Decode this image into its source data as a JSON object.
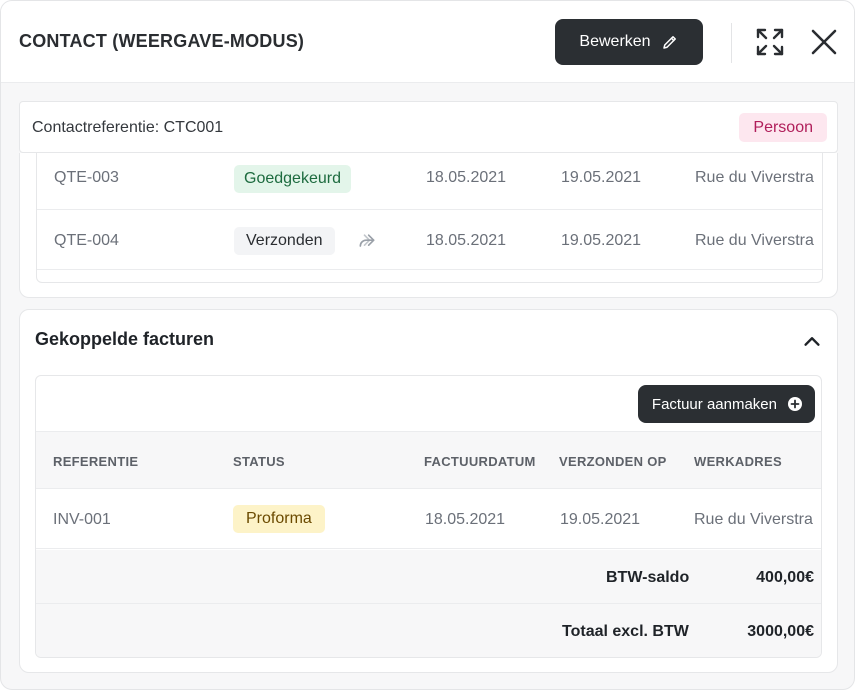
{
  "header": {
    "title": "CONTACT (WEERGAVE-MODUS)",
    "edit_label": "Bewerken"
  },
  "contact": {
    "reference": "Contactreferentie: CTC001",
    "type_badge": "Persoon"
  },
  "quotes": {
    "rows": [
      {
        "ref": "QTE-003",
        "status": "Goedgekeurd",
        "date1": "18.05.2021",
        "date2": "19.05.2021",
        "address": "Rue du Viverstra"
      },
      {
        "ref": "QTE-004",
        "status": "Verzonden",
        "date1": "18.05.2021",
        "date2": "19.05.2021",
        "address": "Rue du Viverstra"
      }
    ]
  },
  "invoices": {
    "title": "Gekoppelde facturen",
    "create_label": "Factuur aanmaken",
    "columns": [
      "REFERENTIE",
      "STATUS",
      "FACTUURDATUM",
      "VERZONDEN OP",
      "WERKADRES"
    ],
    "rows": [
      {
        "ref": "INV-001",
        "status": "Proforma",
        "date1": "18.05.2021",
        "date2": "19.05.2021",
        "address": "Rue du Viverstra"
      }
    ],
    "summary": {
      "vat_label": "BTW-saldo",
      "vat_value": "400,00€",
      "total_label": "Totaal excl. BTW",
      "total_value": "3000,00€"
    }
  },
  "colors": {
    "primary_button": "#2b2f33",
    "badge_pink_bg": "#fde7ef",
    "badge_green_bg": "#e3f5ea",
    "badge_yellow_bg": "#fdf3c8"
  }
}
